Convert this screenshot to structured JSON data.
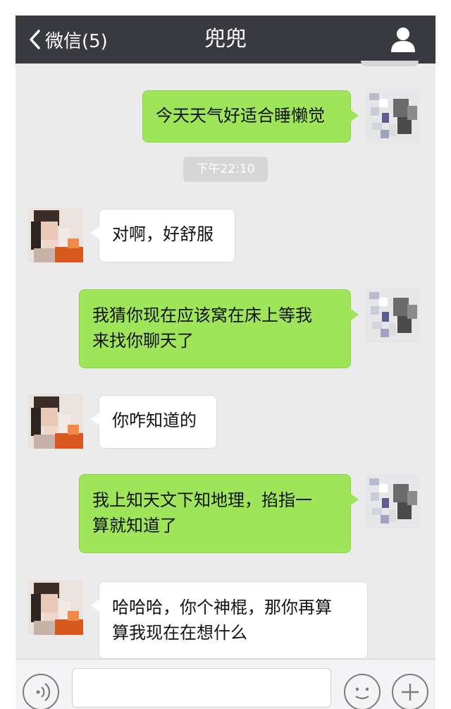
{
  "navbar": {
    "back_label": "微信(5)",
    "title": "兜兜"
  },
  "timestamp": "下午22:10",
  "messages": [
    {
      "side": "me",
      "lines": [
        "今天天气好适合睡懒觉"
      ]
    },
    {
      "side": "other",
      "lines": [
        "对啊，好舒服"
      ]
    },
    {
      "side": "me",
      "lines": [
        "我猜你现在应该窝在床上等我",
        "来找你聊天了"
      ]
    },
    {
      "side": "other",
      "lines": [
        "你咋知道的"
      ]
    },
    {
      "side": "me",
      "lines": [
        "我上知天文下知地理，掐指一",
        "算就知道了"
      ]
    },
    {
      "side": "other",
      "lines": [
        "哈哈哈，你个神棍，那你再算",
        "算我现在在想什么"
      ]
    }
  ],
  "colors": {
    "navbar": "#393a3f",
    "chat_background": "#ebebeb",
    "my_bubble": "#9ee55a",
    "other_bubble": "#ffffff"
  },
  "icons": {
    "back": "chevron-left-icon",
    "profile": "person-icon",
    "voice": "voice-icon",
    "emoji": "emoji-icon",
    "plus": "plus-icon"
  }
}
